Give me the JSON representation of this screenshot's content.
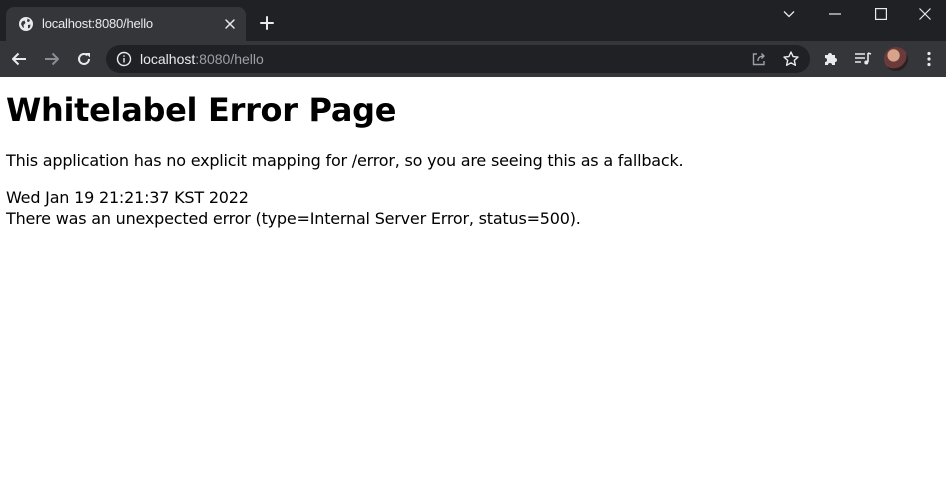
{
  "browser": {
    "tab": {
      "title": "localhost:8080/hello"
    },
    "address_bar": {
      "host": "localhost",
      "path": ":8080/hello"
    }
  },
  "page": {
    "title": "Whitelabel Error Page",
    "message": "This application has no explicit mapping for /error, so you are seeing this as a fallback.",
    "timestamp": "Wed Jan 19 21:21:37 KST 2022",
    "error_detail": "There was an unexpected error (type=Internal Server Error, status=500)."
  },
  "colors": {
    "tabstrip_bg": "#202124",
    "toolbar_bg": "#35363a",
    "omnibox_bg": "#202124",
    "icon_color": "#e8eaed",
    "url_dim": "#9aa0a6"
  }
}
